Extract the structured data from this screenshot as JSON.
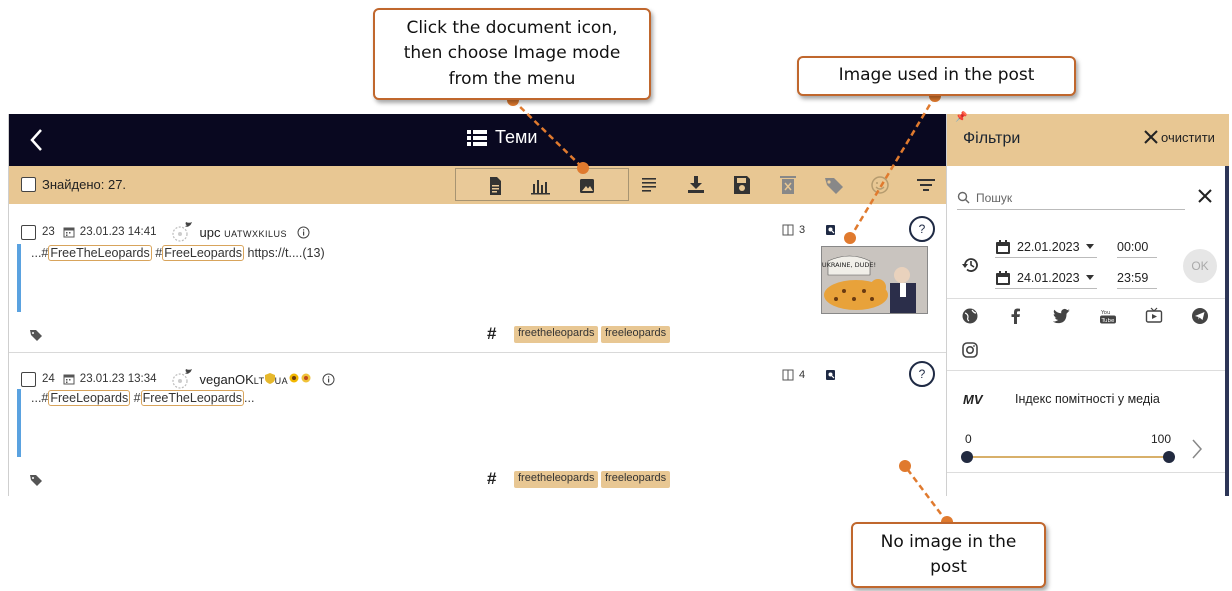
{
  "callouts": {
    "doc_icon": [
      "Click the document icon,",
      "then choose Image mode",
      "from the menu"
    ],
    "image_used": "Image used in the post",
    "no_image": [
      "No image in the",
      "post"
    ]
  },
  "topbar": {
    "title": "Теми"
  },
  "toolbar": {
    "found": "Знайдено: 27."
  },
  "posts": [
    {
      "num": "23",
      "date": "23.01.23 14:41",
      "author": "upc",
      "author_handle": "UATWXKILUS",
      "text_prefix": "...#",
      "hashtag1": "FreeTheLeopards",
      "text_mid1": " #",
      "hashtag2": "FreeLeopards",
      "text_suffix": " https://t....(13)",
      "count": "3",
      "chips": [
        "freetheleopards",
        "freeleopards"
      ],
      "has_image": true,
      "image_caption": "UKRAINE, DUDE!"
    },
    {
      "num": "24",
      "date": "23.01.23 13:34",
      "author": "veganOK",
      "author_handle": "LT",
      "author_tail": "UA",
      "text_prefix": "...#",
      "hashtag1": "FreeLeopards",
      "text_mid1": " #",
      "hashtag2": "FreeTheLeopards",
      "text_suffix": "...",
      "count": "4",
      "chips": [
        "freetheleopards",
        "freeleopards"
      ],
      "has_image": false
    }
  ],
  "q_label": "?",
  "filters": {
    "title": "Фільтри",
    "clear": "очистити",
    "search_placeholder": "Пошук",
    "date_from": "22.01.2023",
    "time_from": "00:00",
    "date_to": "24.01.2023",
    "time_to": "23:59",
    "ok": "OK",
    "mv_badge": "MV",
    "mv_label": "Індекс помітності у медіа",
    "slider_min": "0",
    "slider_max": "100",
    "slider_range": [
      0,
      100
    ]
  },
  "colors": {
    "accent": "#e8c793",
    "topbar": "#090820",
    "callout_border": "#c0672d",
    "post_bar": "#5aa2e0"
  }
}
